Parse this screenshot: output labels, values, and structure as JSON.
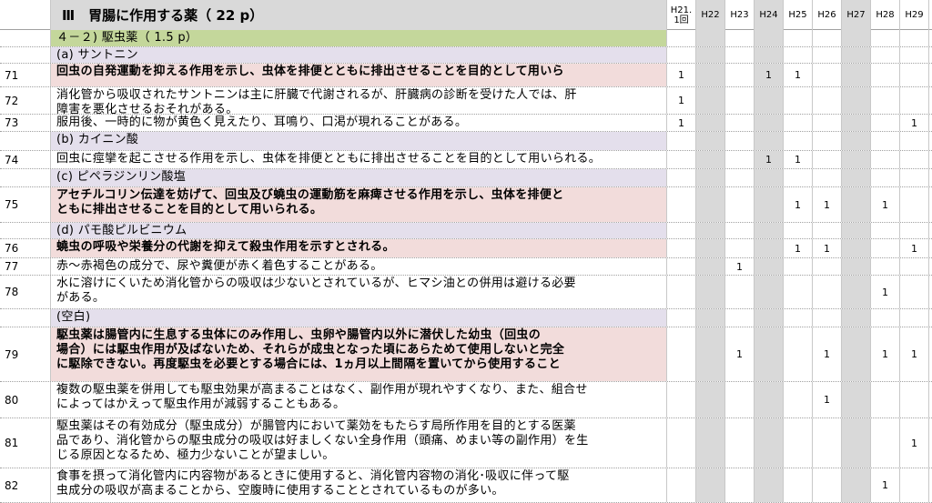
{
  "title": "Ⅲ　胃腸に作用する薬（ 22 p）",
  "year_headers": [
    "H21.\n1回",
    "H22",
    "H23",
    "H24",
    "H25",
    "H26",
    "H27",
    "H28",
    "H29"
  ],
  "rows": [
    {
      "num": "",
      "text": "４－２) 駆虫薬（ 1.5 p）",
      "style": "green",
      "marks": [
        "",
        "",
        "",
        "",
        "",
        "",
        "",
        "",
        ""
      ]
    },
    {
      "num": "",
      "text": "(a) サントニン",
      "style": "lav",
      "marks": [
        "",
        "",
        "",
        "",
        "",
        "",
        "",
        "",
        ""
      ]
    },
    {
      "num": "71",
      "text": "回虫の自発運動を抑える作用を示し、虫体を排便とともに排出させることを目的として用いら",
      "style": "hl-bold",
      "marks": [
        "1",
        "",
        "",
        "1",
        "1",
        "",
        "",
        "",
        ""
      ]
    },
    {
      "num": "72",
      "text": "消化管から吸収されたサントニンは主に肝臓で代謝されるが、肝臓病の診断を受けた人では、肝\n障害を悪化させるおそれがある。",
      "style": "",
      "marks": [
        "1",
        "",
        "",
        "",
        "",
        "",
        "",
        "",
        ""
      ]
    },
    {
      "num": "73",
      "text": "服用後、一時的に物が黄色く見えたり、耳鳴り、口渇が現れることがある。",
      "style": "",
      "marks": [
        "1",
        "",
        "",
        "",
        "",
        "",
        "",
        "",
        "1"
      ]
    },
    {
      "num": "",
      "text": "(b) カイニン酸",
      "style": "lav",
      "marks": [
        "",
        "",
        "",
        "",
        "",
        "",
        "",
        "",
        ""
      ]
    },
    {
      "num": "74",
      "text": "回虫に痙攣を起こさせる作用を示し、虫体を排便とともに排出させることを目的として用いられる。",
      "style": "",
      "marks": [
        "",
        "",
        "",
        "1",
        "1",
        "",
        "",
        "",
        ""
      ]
    },
    {
      "num": "",
      "text": "(c) ピペラジンリン酸塩",
      "style": "lav",
      "marks": [
        "",
        "",
        "",
        "",
        "",
        "",
        "",
        "",
        ""
      ]
    },
    {
      "num": "75",
      "text": "アセチルコリン伝達を妨げて、回虫及び蟯虫の運動筋を麻痺させる作用を示し、虫体を排便と\nともに排出させることを目的として用いられる。",
      "style": "hl-bold",
      "marks": [
        "",
        "",
        "",
        "",
        "1",
        "1",
        "",
        "1",
        ""
      ]
    },
    {
      "num": "",
      "text": "(d) パモ酸ピルビニウム",
      "style": "lav",
      "marks": [
        "",
        "",
        "",
        "",
        "",
        "",
        "",
        "",
        ""
      ]
    },
    {
      "num": "76",
      "text": "蟯虫の呼吸や栄養分の代謝を抑えて殺虫作用を示すとされる。",
      "style": "hl-bold",
      "marks": [
        "",
        "",
        "",
        "",
        "1",
        "1",
        "",
        "",
        "1"
      ]
    },
    {
      "num": "77",
      "text": "赤～赤褐色の成分で、尿や糞便が赤く着色することがある。",
      "style": "",
      "marks": [
        "",
        "",
        "1",
        "",
        "",
        "",
        "",
        "",
        ""
      ]
    },
    {
      "num": "78",
      "text": "水に溶けにくいため消化管からの吸収は少ないとされているが、ヒマシ油との併用は避ける必要\nがある。",
      "style": "",
      "marks": [
        "",
        "",
        "",
        "",
        "",
        "",
        "",
        "1",
        ""
      ]
    },
    {
      "num": "",
      "text": "(空白)",
      "style": "lav",
      "marks": [
        "",
        "",
        "",
        "",
        "",
        "",
        "",
        "",
        ""
      ]
    },
    {
      "num": "79",
      "text": "駆虫薬は腸管内に生息する虫体にのみ作用し、虫卵や腸管内以外に潜伏した幼虫（回虫の\n場合）には駆虫作用が及ばないため、それらが成虫となった頃にあらためて使用しないと完全\nに駆除できない。再度駆虫を必要とする場合には、1ヵ月以上間隔を置いてから使用すること",
      "style": "hl-bold",
      "marks": [
        "",
        "",
        "1",
        "",
        "",
        "1",
        "",
        "1",
        "1"
      ]
    },
    {
      "num": "80",
      "text": "複数の駆虫薬を併用しても駆虫効果が高まることはなく、副作用が現れやすくなり、また、組合せ\nによってはかえって駆虫作用が減弱することもある。",
      "style": "",
      "marks": [
        "",
        "",
        "",
        "",
        "",
        "1",
        "",
        "",
        ""
      ]
    },
    {
      "num": "81",
      "text": "駆虫薬はその有効成分（駆虫成分）が腸管内において薬効をもたらす局所作用を目的とする医薬\n品であり、消化管からの駆虫成分の吸収は好ましくない全身作用（頭痛、めまい等の副作用）を生\nじる原因となるため、極力少ないことが望ましい。",
      "style": "",
      "marks": [
        "",
        "",
        "",
        "",
        "",
        "",
        "",
        "",
        "1"
      ]
    },
    {
      "num": "82",
      "text": "食事を摂って消化管内に内容物があるときに使用すると、消化管内容物の消化･吸収に伴って駆\n虫成分の吸収が高まることから、空腹時に使用することとされているものが多い。",
      "style": "",
      "marks": [
        "",
        "",
        "",
        "",
        "",
        "",
        "",
        "1",
        ""
      ]
    }
  ]
}
